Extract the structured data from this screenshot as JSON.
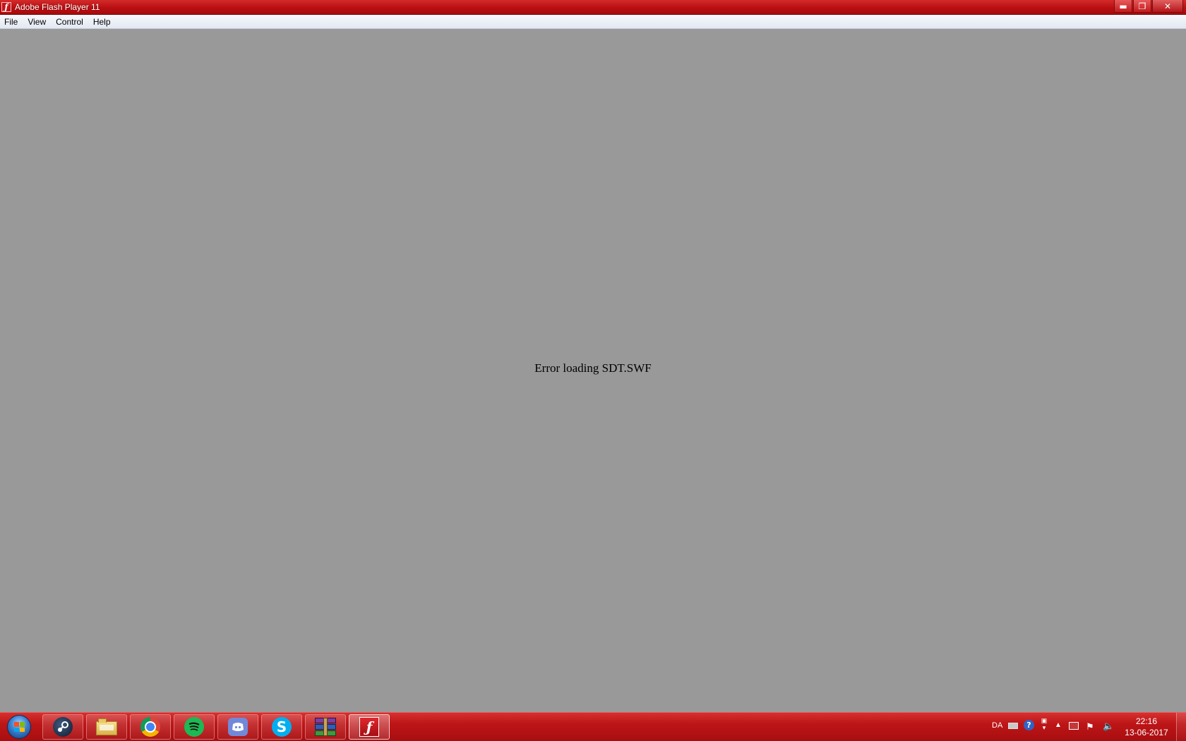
{
  "window": {
    "title": "Adobe Flash Player 11",
    "icon": "flash-icon",
    "controls": {
      "minimize": "minimize-icon",
      "maximize": "restore-icon",
      "close": "close-icon"
    }
  },
  "menu": {
    "items": [
      "File",
      "View",
      "Control",
      "Help"
    ]
  },
  "content": {
    "message": "Error loading SDT.SWF",
    "background": "#999999"
  },
  "taskbar": {
    "accent": "#bd1517",
    "apps": [
      {
        "name": "steam",
        "icon": "steam-icon"
      },
      {
        "name": "file-explorer",
        "icon": "folder-icon"
      },
      {
        "name": "chrome",
        "icon": "chrome-icon"
      },
      {
        "name": "spotify",
        "icon": "spotify-icon"
      },
      {
        "name": "discord",
        "icon": "discord-icon"
      },
      {
        "name": "skype",
        "icon": "skype-icon"
      },
      {
        "name": "winrar",
        "icon": "winrar-icon"
      },
      {
        "name": "flash-player",
        "icon": "flash-icon",
        "active": true
      }
    ],
    "tray": {
      "language": "DA",
      "time": "22:16",
      "date": "13-06-2017"
    }
  }
}
